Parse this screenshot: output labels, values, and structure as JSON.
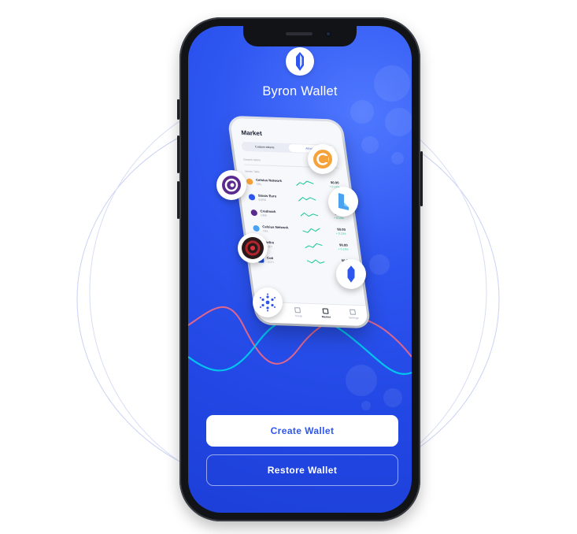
{
  "app": {
    "title": "Byron Wallet",
    "logo_icon": "byron-wallet-logo-icon"
  },
  "preview": {
    "title": "Market",
    "tabs": [
      {
        "label": "Custom tokens",
        "active": false
      },
      {
        "label": "All tokens",
        "active": true
      }
    ],
    "search_placeholder": "Search token",
    "section_label": "Market Table",
    "rows": [
      {
        "name": "Celsius Network",
        "symbol": "CEL",
        "price": "$0.00",
        "change": "+ 0.13%",
        "icon_color": "#f6a23a"
      },
      {
        "name": "Stasis Euro",
        "symbol": "EURS",
        "price": "$0.00",
        "change": "+ 0.13%",
        "icon_color": "#2d55f0"
      },
      {
        "name": "Credmark",
        "symbol": "CMK",
        "price": "$0.00",
        "change": "+ 0.13%",
        "icon_color": "#5b2a8e"
      },
      {
        "name": "Celsius Network",
        "symbol": "CEL",
        "price": "$0.00",
        "change": "+ 0.13%",
        "icon_color": "#4aa3f0"
      },
      {
        "name": "Defire",
        "symbol": "CNET",
        "price": "$0.00",
        "change": "+ 0.13%",
        "icon_color": "#3a2020"
      },
      {
        "name": "Coti",
        "symbol": "COTI",
        "price": "$0.00",
        "change": "+ 0.13%",
        "icon_color": "#1f4fd1"
      }
    ],
    "nav": [
      {
        "label": "Wallet",
        "active": false
      },
      {
        "label": "Swap",
        "active": false
      },
      {
        "label": "Market",
        "active": true
      },
      {
        "label": "Settings",
        "active": false
      }
    ]
  },
  "floating_coins": [
    {
      "icon": "cred-coin-icon",
      "color": "#5b2a8e"
    },
    {
      "icon": "celsius-coin-icon",
      "color": "#f6a23a"
    },
    {
      "icon": "l-token-coin-icon",
      "color": "#4aa3f0"
    },
    {
      "icon": "defire-coin-icon",
      "color": "#b4242c"
    },
    {
      "icon": "byron-coin-icon",
      "color": "#2d55f0"
    },
    {
      "icon": "cardano-coin-icon",
      "color": "#2d55f0"
    }
  ],
  "actions": {
    "create_label": "Create Wallet",
    "restore_label": "Restore Wallet"
  },
  "colors": {
    "accent": "#2d55f0",
    "screen_bg": "#2247e4",
    "positive": "#18c79a",
    "line_red": "#ff6b7a",
    "line_cyan": "#00d0f0"
  }
}
